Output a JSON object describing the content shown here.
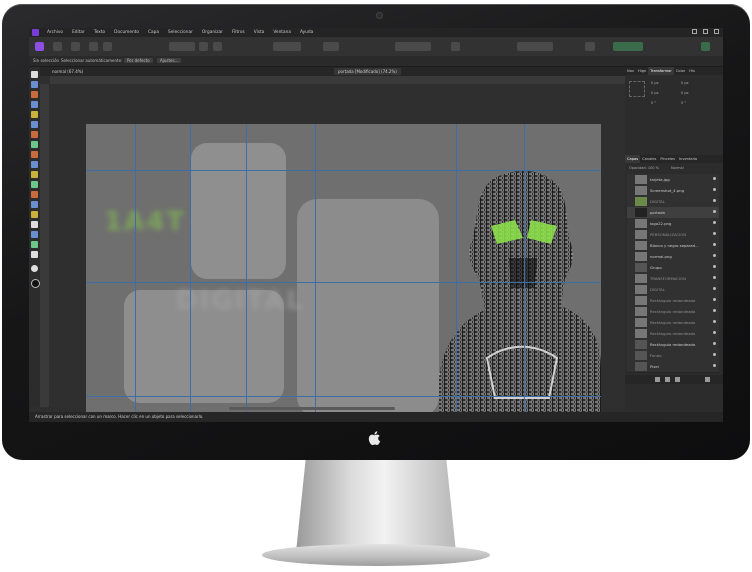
{
  "menubar": {
    "items": [
      "Archivo",
      "Editar",
      "Texto",
      "Documento",
      "Capa",
      "Seleccionar",
      "Organizar",
      "Filtros",
      "Vista",
      "Ventana",
      "Ayuda"
    ]
  },
  "context_toolbar": {
    "selection_label": "Sin selección",
    "auto_select_label": "Seleccionar automáticamente:",
    "auto_select_value": "Por defecto",
    "settings_button": "Ajustes..."
  },
  "document_tabs": [
    {
      "label": "normal (67.4%)"
    },
    {
      "label": "portada [Modificado] (74.2%)"
    }
  ],
  "status_bar": {
    "text": "Arrastrar para seleccionar con un marco. Hacer clic en un objeto para seleccionarlo."
  },
  "transform_panel": {
    "tabs": [
      "Nav",
      "Hign",
      "Transformar",
      "Color",
      "His"
    ],
    "fields": {
      "x": "0 px",
      "y": "0 px",
      "w": "0 px",
      "h": "0 px",
      "r": "0 °",
      "s": "0 °"
    }
  },
  "layers_panel": {
    "tabs": [
      "Capas",
      "Canales",
      "Pinceles",
      "Inventario"
    ],
    "opacity": "Opacidad: 100 %",
    "blend_mode": "Normal",
    "layers": [
      {
        "name": "tarjeta.jpg"
      },
      {
        "name": "Screenshot_4.png"
      },
      {
        "name": "DIGITAL"
      },
      {
        "name": "portada"
      },
      {
        "name": "logo22.png"
      },
      {
        "name": "PERSONALIZACION"
      },
      {
        "name": "Blanco y negro separad..."
      },
      {
        "name": "normal.png"
      },
      {
        "name": "Grupo"
      },
      {
        "name": "TRANSFORMACION"
      },
      {
        "name": "DIGITAL"
      },
      {
        "name": "Rectángulo redondeado"
      },
      {
        "name": "Rectángulo redondeado"
      },
      {
        "name": "Rectángulo redondeado"
      },
      {
        "name": "Rectángulo redondeado"
      },
      {
        "name": "Rectángulo redondeado"
      },
      {
        "name": "Fondo"
      },
      {
        "name": "Pixel"
      },
      {
        "name": "Fondo"
      }
    ]
  },
  "colors": {
    "app_accent": "#8c4fe6",
    "canvas_bg": "#6f6f6f",
    "guide": "#3f6da8",
    "highlight_green": "#8ee64a"
  }
}
